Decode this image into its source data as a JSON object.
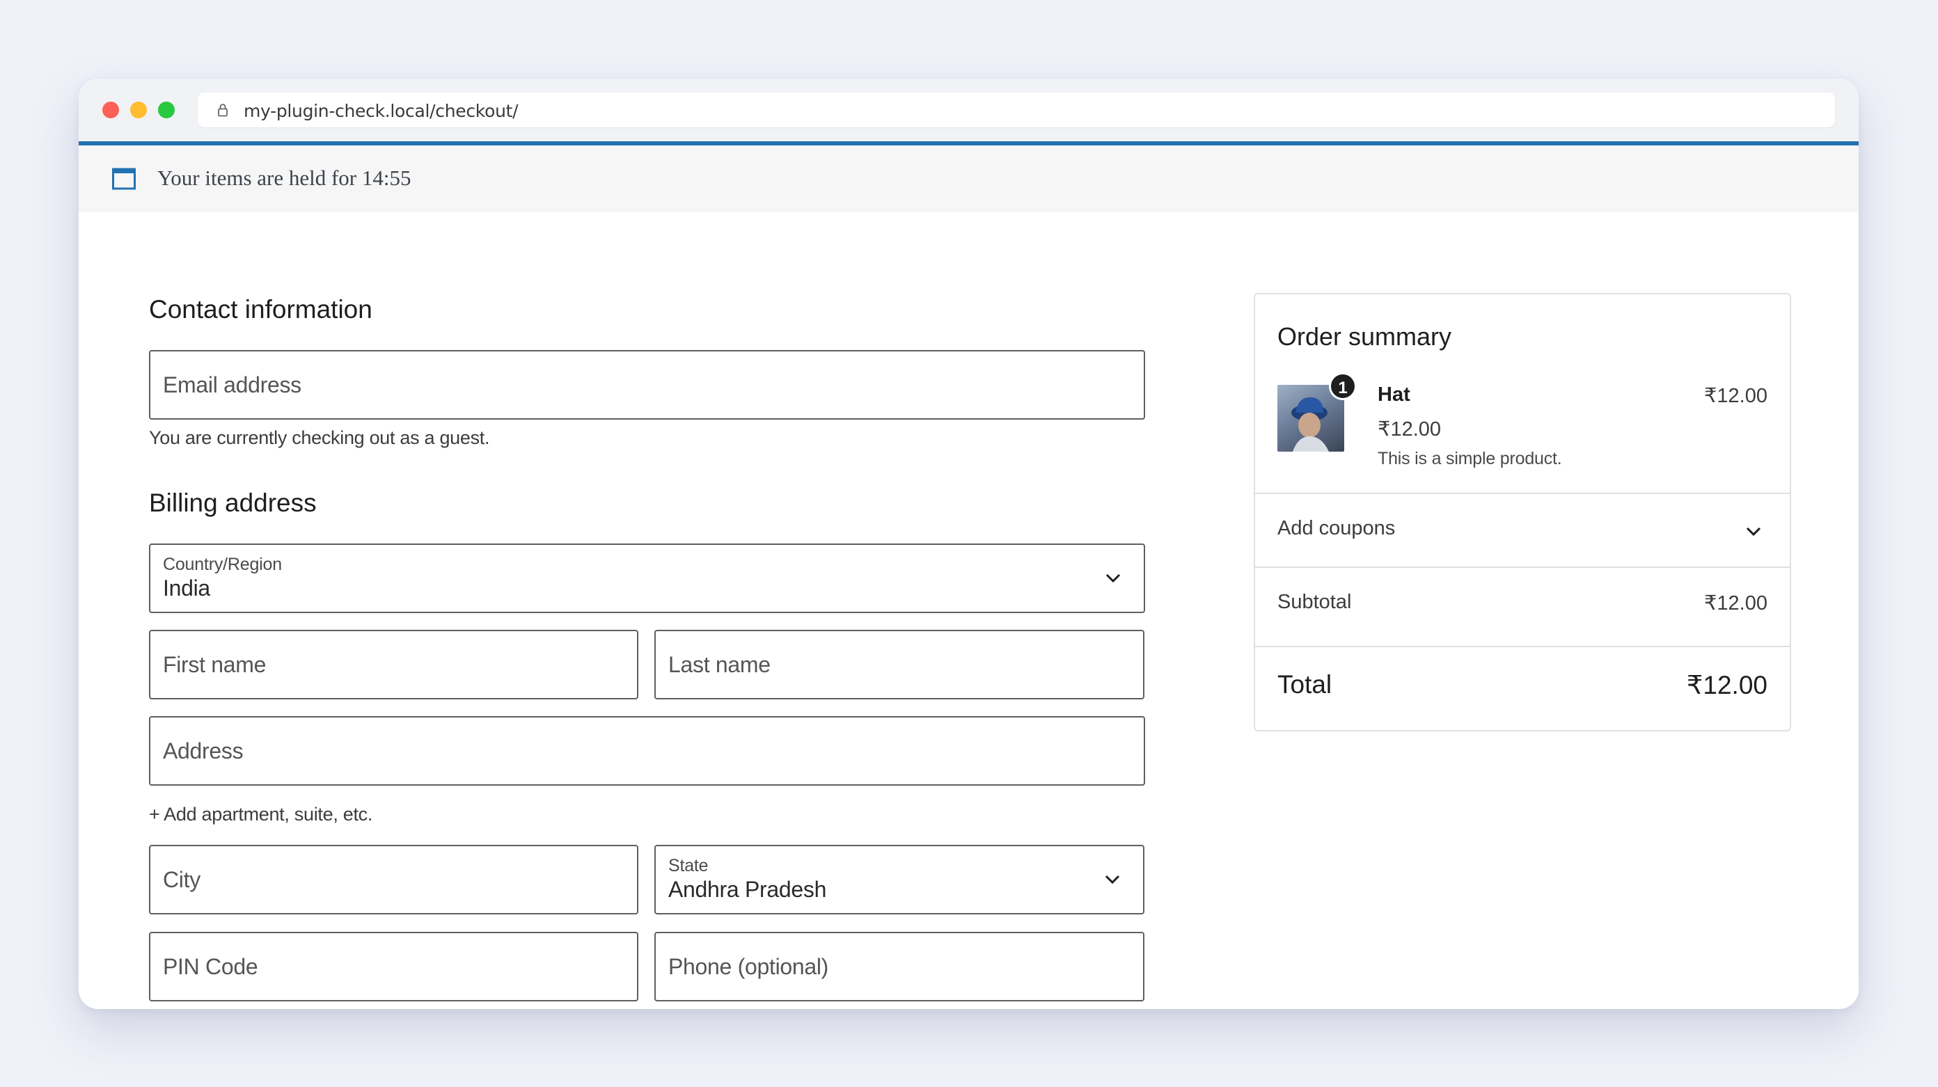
{
  "browser": {
    "url": "my-plugin-check.local/checkout/"
  },
  "notice": {
    "text": "Your items are held for 14:55"
  },
  "contact": {
    "title": "Contact information",
    "email_placeholder": "Email address",
    "guest_note": "You are currently checking out as a guest."
  },
  "billing": {
    "title": "Billing address",
    "country_label": "Country/Region",
    "country_value": "India",
    "first_name_placeholder": "First name",
    "last_name_placeholder": "Last name",
    "address_placeholder": "Address",
    "add_apartment": "+ Add apartment, suite, etc.",
    "city_placeholder": "City",
    "state_label": "State",
    "state_value": "Andhra Pradesh",
    "pin_placeholder": "PIN Code",
    "phone_placeholder": "Phone (optional)"
  },
  "summary": {
    "title": "Order summary",
    "item": {
      "quantity": "1",
      "name": "Hat",
      "line_price": "₹12.00",
      "unit_price": "₹12.00",
      "description": "This is a simple product."
    },
    "coupons_label": "Add coupons",
    "subtotal_label": "Subtotal",
    "subtotal_value": "₹12.00",
    "total_label": "Total",
    "total_value": "₹12.00"
  },
  "colors": {
    "accent": "#2271b1",
    "close": "#fe5f57",
    "minimize": "#febc2e",
    "maximize": "#28c840"
  }
}
